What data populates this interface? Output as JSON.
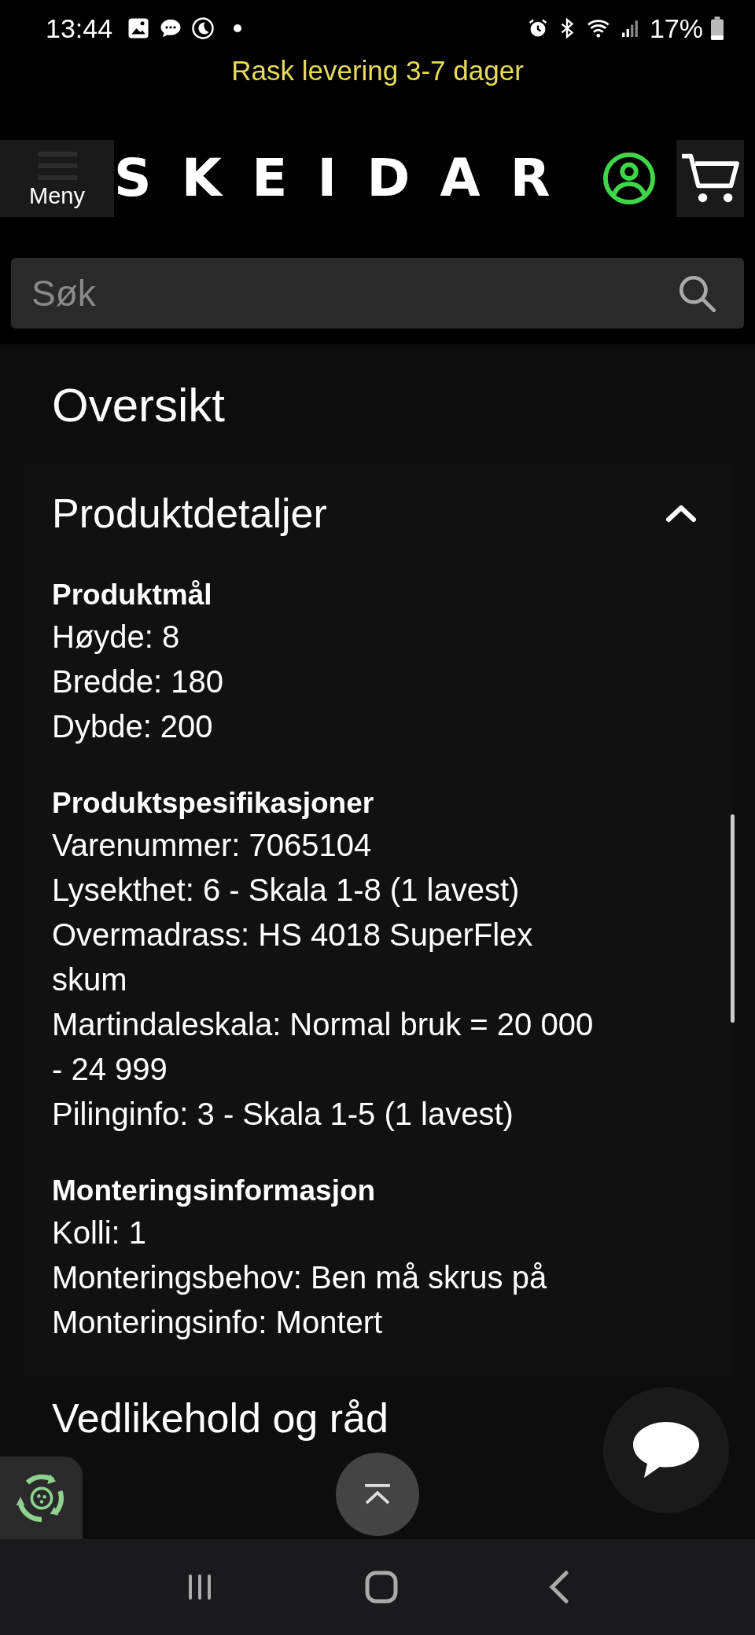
{
  "status_bar": {
    "time": "13:44",
    "battery": "17%"
  },
  "promo": "Rask levering 3-7 dager",
  "header": {
    "menu_label": "Meny",
    "logo": "SKEIDAR"
  },
  "search": {
    "placeholder": "Søk"
  },
  "page_title": "Oversikt",
  "accordion": {
    "title": "Produktdetaljer",
    "expanded": true,
    "sections": [
      {
        "heading": "Produktmål",
        "lines": [
          "Høyde: 8",
          "Bredde: 180",
          "Dybde: 200"
        ]
      },
      {
        "heading": "Produktspesifikasjoner",
        "lines": [
          "Varenummer: 7065104",
          "Lysekthet: 6 - Skala 1-8 (1 lavest)",
          "Overmadrass: HS 4018 SuperFlex skum",
          "Martindaleskala: Normal bruk = 20 000 - 24 999",
          "Pilinginfo: 3 - Skala 1-5 (1 lavest)"
        ]
      },
      {
        "heading": "Monteringsinformasjon",
        "lines": [
          "Kolli: 1",
          "Monteringsbehov: Ben må skrus på",
          "Monteringsinfo: Montert"
        ]
      }
    ]
  },
  "next_section": {
    "title": "Vedlikehold og råd"
  }
}
